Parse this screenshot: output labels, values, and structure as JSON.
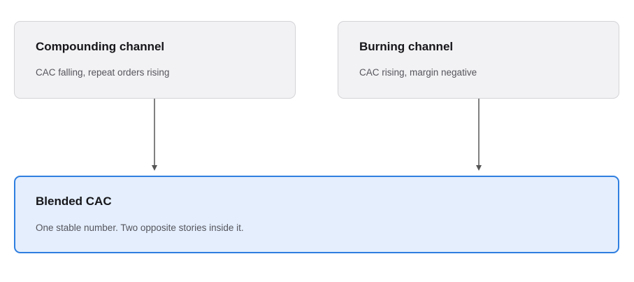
{
  "nodes": {
    "compounding": {
      "title": "Compounding channel",
      "description": "CAC falling, repeat orders rising"
    },
    "burning": {
      "title": "Burning channel",
      "description": "CAC rising, margin negative"
    },
    "blended": {
      "title": "Blended CAC",
      "description": "One stable number. Two opposite stories inside it."
    }
  },
  "edges": [
    {
      "from": "compounding",
      "to": "blended"
    },
    {
      "from": "burning",
      "to": "blended"
    }
  ],
  "colors": {
    "source_fill": "#f2f2f4",
    "source_border": "#d4d4d8",
    "target_fill": "#e4eefd",
    "target_border": "#2f7fe0",
    "edge": "#555555"
  }
}
